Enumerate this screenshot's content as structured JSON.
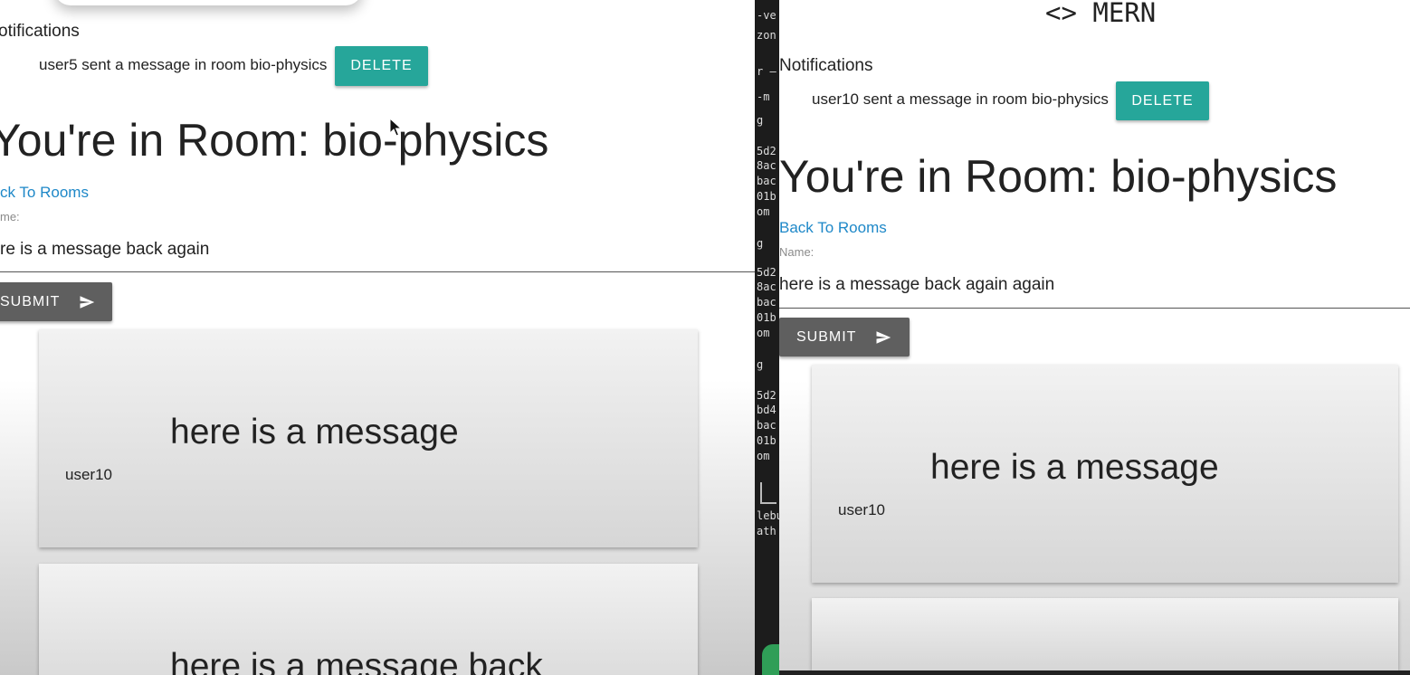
{
  "left": {
    "notifications_heading": "otifications",
    "notification_text": "user5 sent a message in room bio-physics",
    "delete_label": "DELETE",
    "room_title": "You're in Room: bio-physics",
    "back_link": "ck To Rooms",
    "name_label": "me:",
    "input_value": "re is a message back again",
    "submit_label": "SUBMIT",
    "messages": [
      {
        "text": "here is a message",
        "user": "user10"
      },
      {
        "text": "here is a message back",
        "user": ""
      }
    ]
  },
  "terminal": {
    "lines": [
      "-ve",
      "zon",
      "",
      "r —",
      "-m",
      "",
      "g",
      "5d2",
      "8ac",
      "bac",
      "01b",
      "om",
      "",
      "g",
      "5d2",
      "8ac",
      "bac",
      "01b",
      "om",
      "",
      "g",
      "5d2",
      "bd4",
      "bac",
      "01b",
      "om",
      "",
      "",
      "lebu",
      "ath"
    ]
  },
  "right": {
    "logo": "<> MERN",
    "notifications_heading": "Notifications",
    "notification_text": "user10 sent a message in room bio-physics",
    "delete_label": "DELETE",
    "room_title": "You're in Room: bio-physics",
    "back_link": "Back To Rooms",
    "name_label": "Name:",
    "input_value": "here is a message back again again",
    "submit_label": "SUBMIT",
    "messages": [
      {
        "text": "here is a message",
        "user": "user10"
      },
      {
        "text": "",
        "user": ""
      }
    ]
  },
  "icons": {
    "send": "send-icon",
    "cursor": "mouse-cursor-icon"
  },
  "colors": {
    "accent": "#26a69a",
    "link": "#1e88c8",
    "submit": "#5f5f5f"
  }
}
